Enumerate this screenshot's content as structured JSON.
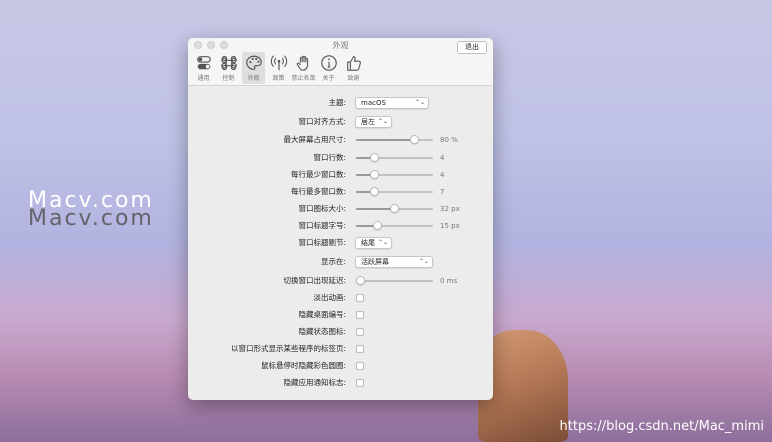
{
  "window": {
    "title": "外观",
    "quit_label": "退出"
  },
  "toolbar": [
    {
      "icon": "toggle-icon",
      "label": "通用",
      "active": false
    },
    {
      "icon": "command-icon",
      "label": "控制",
      "active": false
    },
    {
      "icon": "palette-icon",
      "label": "外观",
      "active": true
    },
    {
      "icon": "antenna-icon",
      "label": "政策",
      "active": false
    },
    {
      "icon": "hand-icon",
      "label": "禁止名单",
      "active": false
    },
    {
      "icon": "info-icon",
      "label": "关于",
      "active": false
    },
    {
      "icon": "thumbs-up-icon",
      "label": "致谢",
      "active": false
    }
  ],
  "settings": {
    "theme": {
      "label": "主题:",
      "value": "macOS",
      "apple_glyph": ""
    },
    "alignment": {
      "label": "窗口对齐方式:",
      "value": "居左"
    },
    "max_screen": {
      "label": "最大屏幕占用尺寸:",
      "value": "80 %",
      "level": 0.8
    },
    "rows": {
      "label": "窗口行数:",
      "value": "4",
      "level": 0.2
    },
    "min_per_row": {
      "label": "每行最少窗口数:",
      "value": "4",
      "level": 0.2
    },
    "max_per_row": {
      "label": "每行最多窗口数:",
      "value": "7",
      "level": 0.2
    },
    "icon_size": {
      "label": "窗口图标大小:",
      "value": "32 px",
      "level": 0.5
    },
    "title_font": {
      "label": "窗口标题字号:",
      "value": "15 px",
      "level": 0.25
    },
    "title_truncate": {
      "label": "窗口标题剔节:",
      "value": "结尾"
    },
    "show_on": {
      "label": "显示在:",
      "value": "活跃屏幕"
    },
    "delay": {
      "label": "切换窗口出现延迟:",
      "value": "0 ms",
      "level": 0.0
    },
    "fade": {
      "label": "淡出动画:"
    },
    "hide_desktop_num": {
      "label": "隐藏桌面编号:"
    },
    "hide_status_icon": {
      "label": "隐藏状态图标:"
    },
    "tabs_as_windows": {
      "label": "以窗口形式显示某些程序的标签页:"
    },
    "hide_color_circles": {
      "label": "鼠标悬停时隐藏彩色圆圈:"
    },
    "hide_badges": {
      "label": "隐藏应用通知标志:"
    }
  },
  "desktop": {
    "watermark": "Macv.com",
    "watermark2": "Macv.com",
    "url": "https://blog.csdn.net/Mac_mimi"
  }
}
